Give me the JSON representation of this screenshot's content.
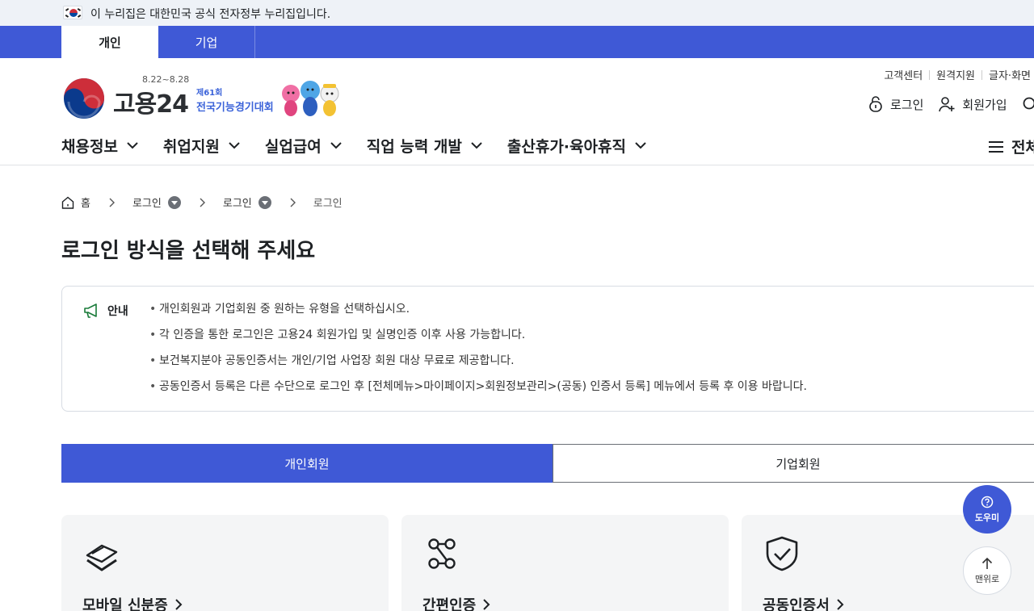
{
  "gov_banner": {
    "text": "이 누리집은 대한민국 공식 전자정부 누리집입니다.",
    "flag_icon": "korea-flag-icon"
  },
  "user_type_tabs": [
    {
      "label": "개인",
      "active": true
    },
    {
      "label": "기업",
      "active": false
    }
  ],
  "logo": {
    "brand": "고용24",
    "dates": "8.22~8.28",
    "contest_line1": "제61회",
    "contest_line2": "전국기능경기대회"
  },
  "util_links": [
    "고객센터",
    "원격지원",
    "글자·화면"
  ],
  "util_actions": {
    "login": "로그인",
    "signup": "회원가입"
  },
  "gnb": [
    "채용정보",
    "취업지원",
    "실업급여",
    "직업 능력 개발",
    "출산휴가·육아휴직"
  ],
  "all_menu": "전체",
  "breadcrumb": {
    "home": "홈",
    "level1": "로그인",
    "level2": "로그인",
    "current": "로그인"
  },
  "page_title": "로그인 방식을 선택해 주세요",
  "notice": {
    "title": "안내",
    "items": [
      "개인회원과 기업회원 중 원하는 유형을 선택하십시오.",
      "각 인증을 통한 로그인은 고용24 회원가입 및 실명인증 이후 사용 가능합니다.",
      "보건복지분야 공동인증서는 개인/기업 사업장 회원 대상 무료로 제공합니다.",
      "공동인증서 등록은 다른 수단으로 로그인 후 [전체메뉴>마이페이지>회원정보관리>(공동) 인증서 등록] 메뉴에서 등록 후 이용 바랍니다."
    ]
  },
  "member_tabs": [
    {
      "label": "개인회원",
      "active": true
    },
    {
      "label": "기업회원",
      "active": false
    }
  ],
  "login_methods": [
    {
      "label": "모바일 신분증",
      "icon": "mobile-id-icon"
    },
    {
      "label": "간편인증",
      "icon": "simple-auth-icon"
    },
    {
      "label": "공동인증서",
      "icon": "shield-check-icon"
    }
  ],
  "floating": {
    "help": "도우미",
    "top": "맨위로"
  },
  "colors": {
    "primary": "#3f59d6",
    "banner_bg": "#eef2f7",
    "card_bg": "#f4f5f6",
    "notice_icon": "#1a7b3a"
  }
}
